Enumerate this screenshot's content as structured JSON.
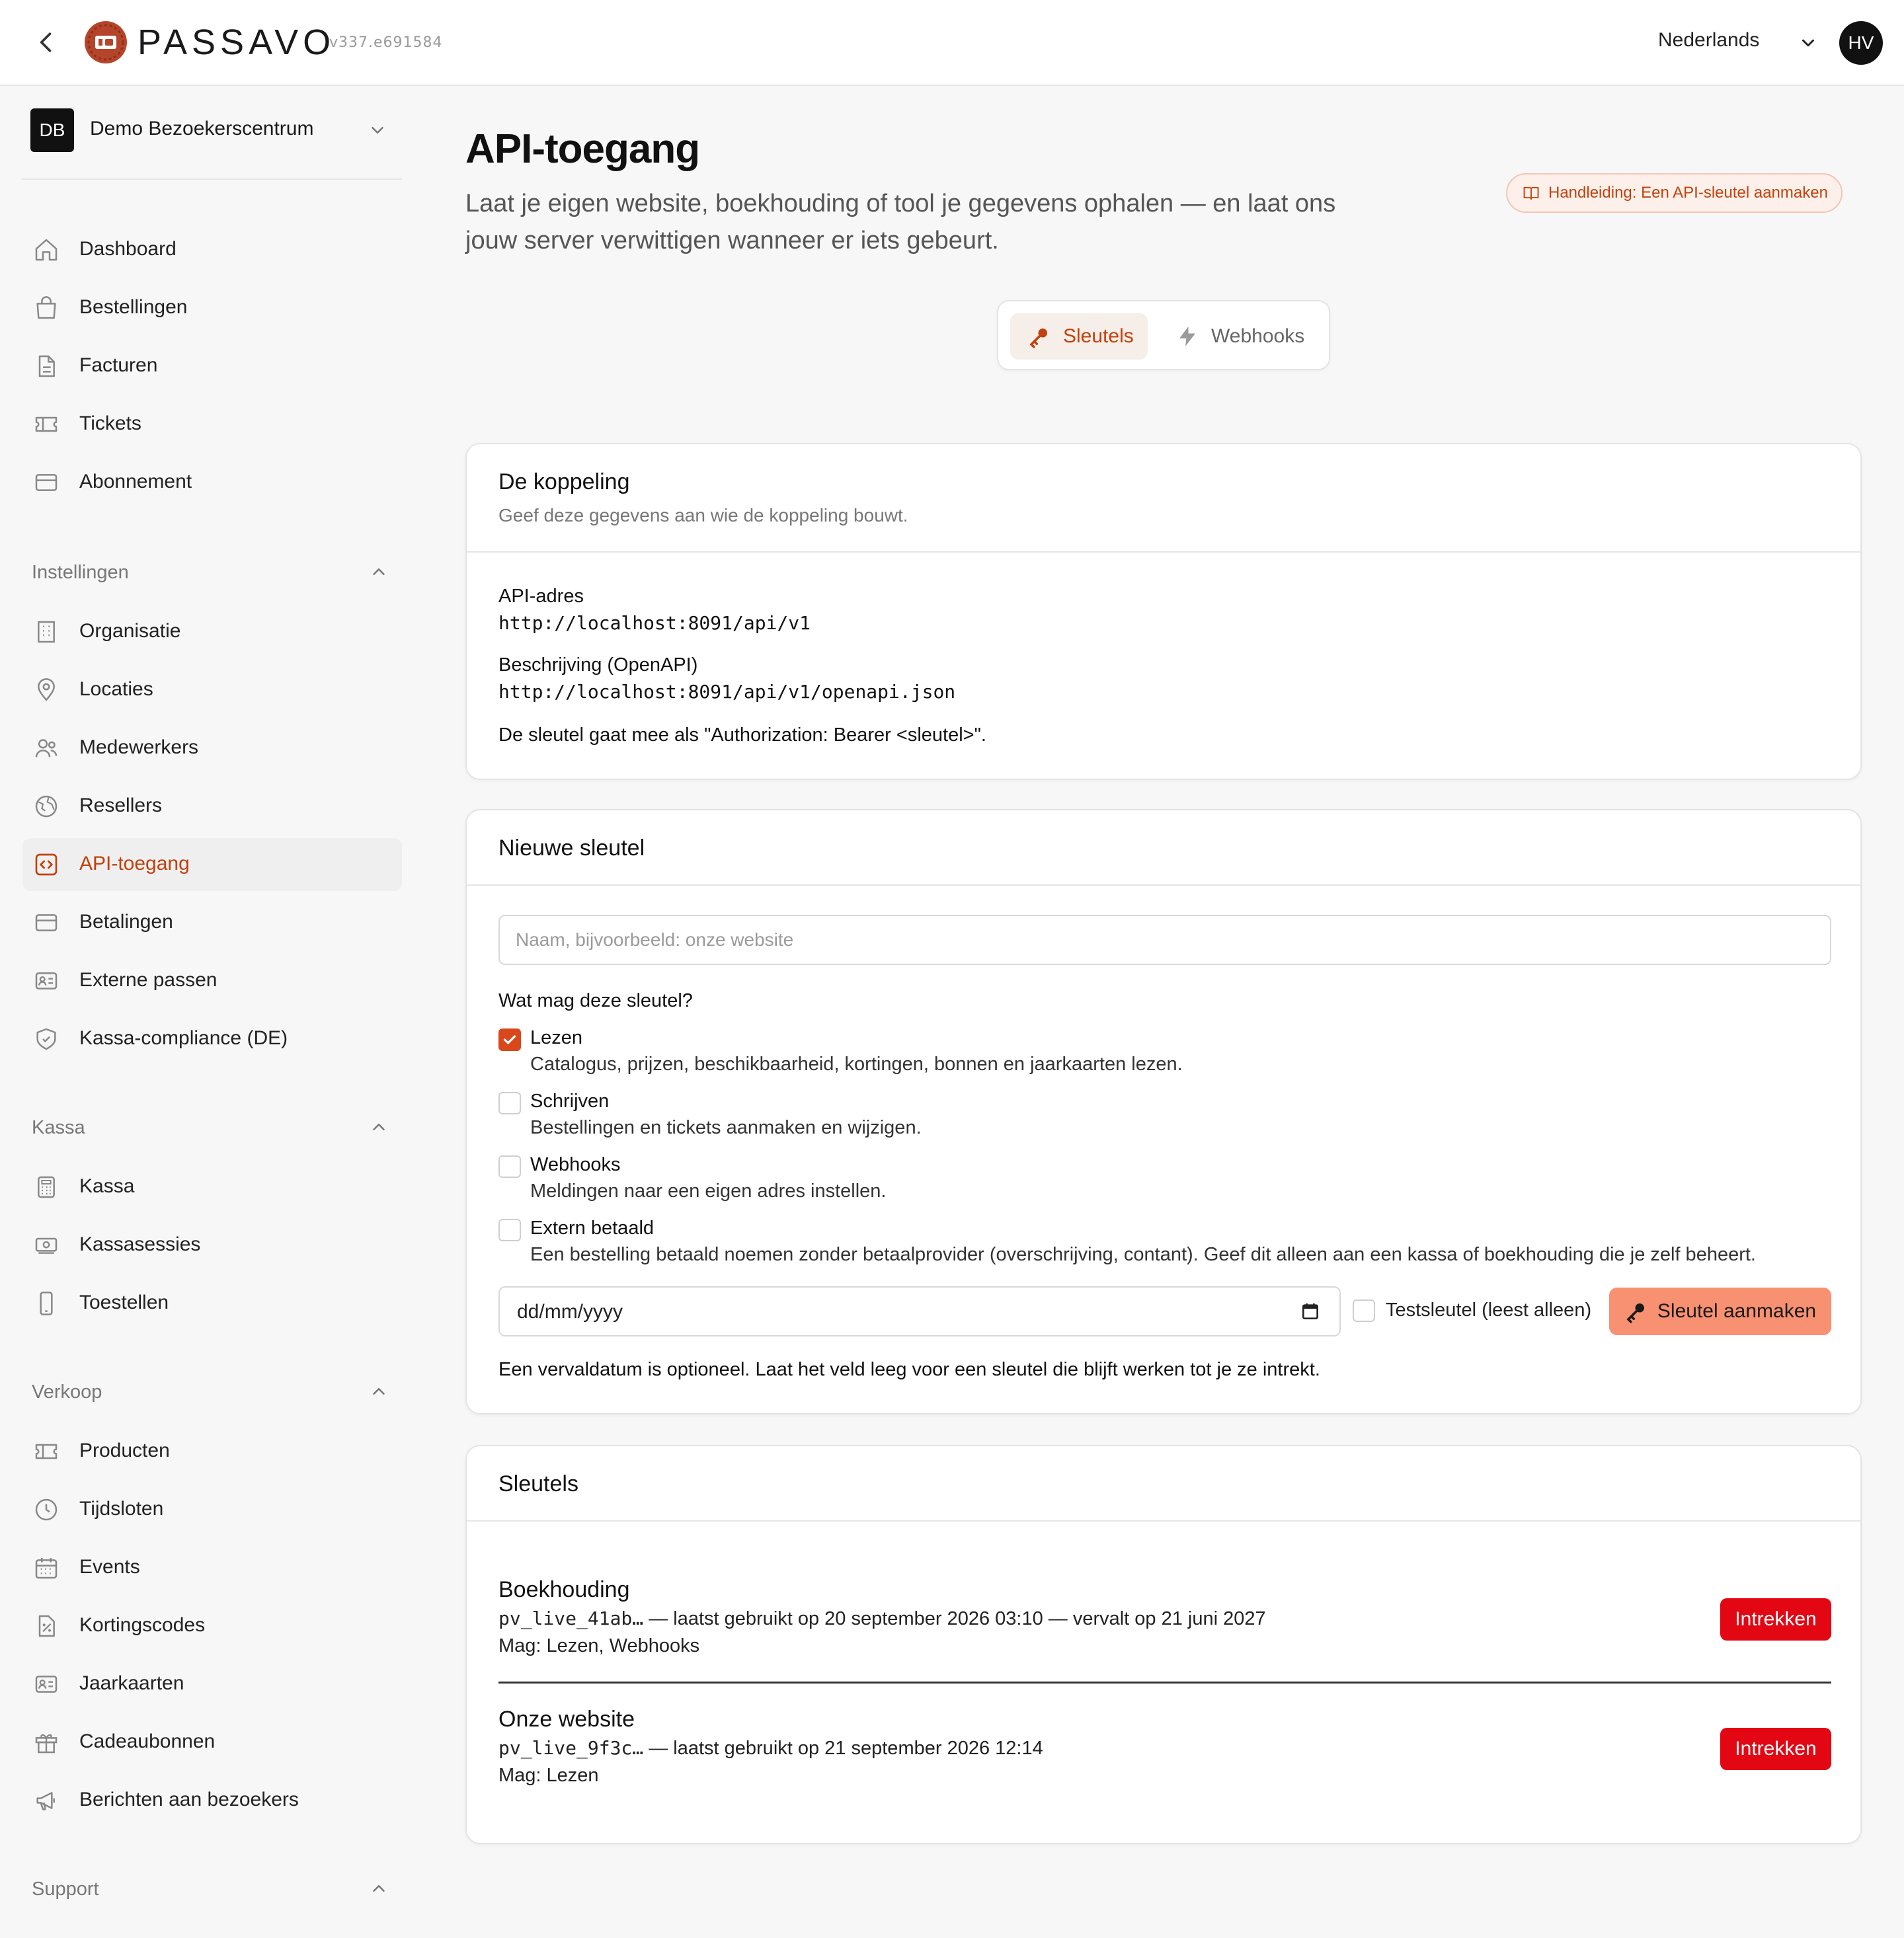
{
  "topbar": {
    "brand": "PASSAVO",
    "version": "v337.e691584",
    "language": "Nederlands",
    "avatar_initials": "HV",
    "icons": [
      "chevron-left-icon",
      "passavo-logo",
      "chevron-down-icon"
    ]
  },
  "sidebar": {
    "org": {
      "initials": "DB",
      "name": "Demo Bezoekerscentrum"
    },
    "main_items": [
      {
        "label": "Dashboard",
        "icon": "home-icon"
      },
      {
        "label": "Bestellingen",
        "icon": "shopping-bag-icon"
      },
      {
        "label": "Facturen",
        "icon": "document-icon"
      },
      {
        "label": "Tickets",
        "icon": "ticket-icon"
      },
      {
        "label": "Abonnement",
        "icon": "credit-card-icon"
      }
    ],
    "sections": [
      {
        "title": "Instellingen",
        "items": [
          {
            "label": "Organisatie",
            "icon": "building-icon"
          },
          {
            "label": "Locaties",
            "icon": "map-pin-icon"
          },
          {
            "label": "Medewerkers",
            "icon": "users-icon"
          },
          {
            "label": "Resellers",
            "icon": "globe-icon"
          },
          {
            "label": "API-toegang",
            "icon": "code-icon",
            "active": true
          },
          {
            "label": "Betalingen",
            "icon": "credit-card-icon"
          },
          {
            "label": "Externe passen",
            "icon": "id-card-icon"
          },
          {
            "label": "Kassa-compliance (DE)",
            "icon": "shield-check-icon"
          }
        ]
      },
      {
        "title": "Kassa",
        "items": [
          {
            "label": "Kassa",
            "icon": "calculator-icon"
          },
          {
            "label": "Kassasessies",
            "icon": "cash-icon"
          },
          {
            "label": "Toestellen",
            "icon": "phone-icon"
          }
        ]
      },
      {
        "title": "Verkoop",
        "items": [
          {
            "label": "Producten",
            "icon": "ticket-icon"
          },
          {
            "label": "Tijdsloten",
            "icon": "clock-icon"
          },
          {
            "label": "Events",
            "icon": "calendar-icon"
          },
          {
            "label": "Kortingscodes",
            "icon": "discount-icon"
          },
          {
            "label": "Jaarkaarten",
            "icon": "id-card-icon"
          },
          {
            "label": "Cadeaubonnen",
            "icon": "gift-icon"
          },
          {
            "label": "Berichten aan bezoekers",
            "icon": "megaphone-icon"
          }
        ]
      },
      {
        "title": "Support",
        "items": []
      }
    ]
  },
  "page": {
    "title": "API-toegang",
    "subtitle": "Laat je eigen website, boekhouding of tool je gegevens ophalen — en laat ons jouw server verwittigen wanneer er iets gebeurt.",
    "guide_link": "Handleiding: Een API-sleutel aanmaken",
    "tabs": [
      {
        "label": "Sleutels",
        "icon": "key-icon",
        "active": true
      },
      {
        "label": "Webhooks",
        "icon": "bolt-icon",
        "active": false
      }
    ]
  },
  "koppeling": {
    "title": "De koppeling",
    "subtitle": "Geef deze gegevens aan wie de koppeling bouwt.",
    "api_label": "API-adres",
    "api_value": "http://localhost:8091/api/v1",
    "openapi_label": "Beschrijving (OpenAPI)",
    "openapi_value": "http://localhost:8091/api/v1/openapi.json",
    "auth_note": "De sleutel gaat mee als \"Authorization: Bearer <sleutel>\"."
  },
  "new_key": {
    "title": "Nieuwe sleutel",
    "name_placeholder": "Naam, bijvoorbeeld: onze website",
    "name_value": "",
    "question": "Wat mag deze sleutel?",
    "permissions": [
      {
        "label": "Lezen",
        "desc": "Catalogus, prijzen, beschikbaarheid, kortingen, bonnen en jaarkaarten lezen.",
        "checked": true
      },
      {
        "label": "Schrijven",
        "desc": "Bestellingen en tickets aanmaken en wijzigen.",
        "checked": false
      },
      {
        "label": "Webhooks",
        "desc": "Meldingen naar een eigen adres instellen.",
        "checked": false
      },
      {
        "label": "Extern betaald",
        "desc": "Een bestelling betaald noemen zonder betaalprovider (overschrijving, contant). Geef dit alleen aan een kassa of boekhouding die je zelf beheert.",
        "checked": false
      }
    ],
    "date_value": "dd/mm/yyyy",
    "test_label": "Testsleutel (leest alleen)",
    "test_checked": false,
    "create_label": "Sleutel aanmaken",
    "expiry_note": "Een vervaldatum is optioneel. Laat het veld leeg voor een sleutel die blijft werken tot je ze intrekt."
  },
  "keys": {
    "title": "Sleutels",
    "items": [
      {
        "name": "Boekhouding",
        "prefix": "pv_live_41ab…",
        "info": " — laatst gebruikt op 20 september 2026 03:10 — vervalt op 21 juni 2027",
        "perms": "Mag: Lezen, Webhooks",
        "revoke": "Intrekken"
      },
      {
        "name": "Onze website",
        "prefix": "pv_live_9f3c…",
        "info": " — laatst gebruikt op 21 september 2026 12:14",
        "perms": "Mag: Lezen",
        "revoke": "Intrekken"
      }
    ]
  },
  "colors": {
    "accent": "#c2410c",
    "primary_button": "#f89171",
    "danger": "#e30613",
    "active_bg": "#efefef"
  }
}
